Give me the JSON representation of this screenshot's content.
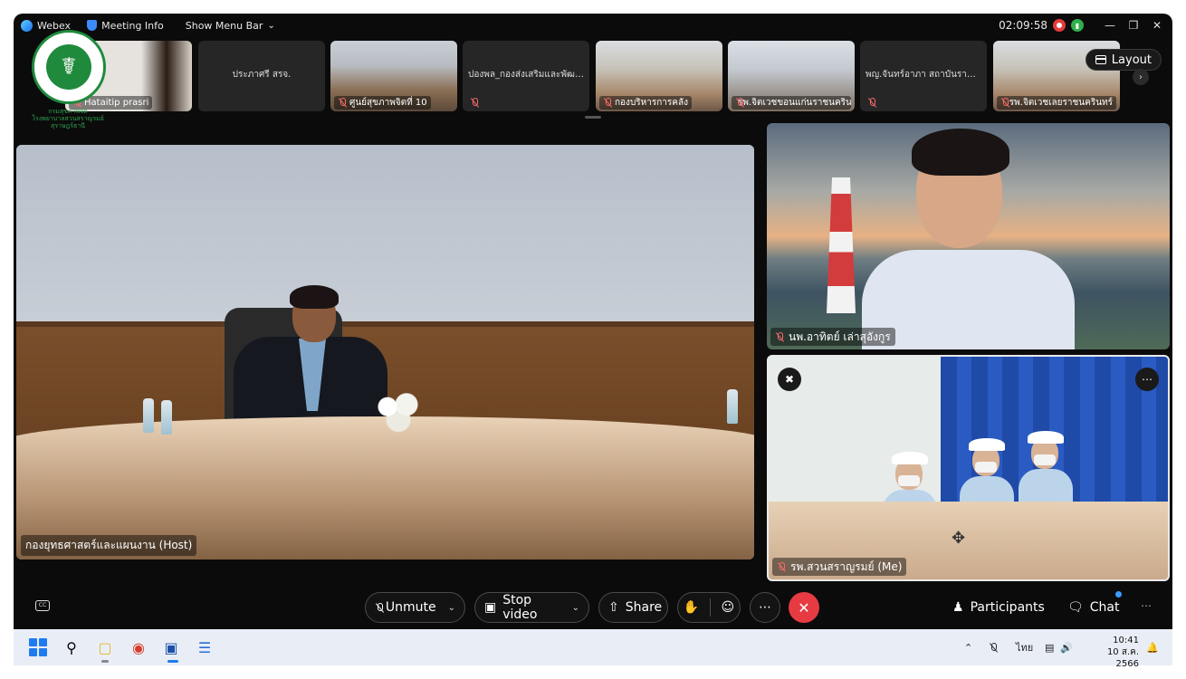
{
  "app": {
    "name": "Webex",
    "meeting_info": "Meeting Info",
    "show_menu_bar": "Show Menu Bar",
    "timer": "02:09:58"
  },
  "logo": {
    "text_line1": "กรมสุขภาพจิต",
    "text_line2": "โรงพยาบาลสวนสราญรมย์",
    "text_line3": "สุราษฎร์ธานี"
  },
  "thumbnails": [
    {
      "name": "Hataitip prasri",
      "muted": true
    },
    {
      "name": "ประภาศรี สรจ.",
      "muted": false
    },
    {
      "name": "ศูนย์สุขภาพจิตที่ 10",
      "muted": true
    },
    {
      "name": "ปองพล_กองส่งเสริมและพัฒน...",
      "muted": true
    },
    {
      "name": "กองบริหารการคลัง",
      "muted": true
    },
    {
      "name": "รพ.จิตเวชขอนแก่นราชนครินทร์",
      "muted": true
    },
    {
      "name": "พญ.จันทร์อาภา สถาบันราชา...",
      "muted": true
    },
    {
      "name": "รพ.จิตเวชเลยราชนครินทร์",
      "muted": true
    }
  ],
  "layout_label": "Layout",
  "main_video": {
    "label": "กองยุทธศาสตร์และแผนงาน (Host)"
  },
  "right_videos": [
    {
      "label": "นพ.อาทิตย์ เล่าสุอังกูร"
    },
    {
      "label": "รพ.สวนสราญรมย์ (Me)"
    }
  ],
  "controls": {
    "unmute": "Unmute",
    "stop_video": "Stop video",
    "share": "Share",
    "participants": "Participants",
    "chat": "Chat"
  },
  "taskbar": {
    "language": "ไทย",
    "time": "10:41",
    "date": "10 ส.ค. 2566"
  },
  "colors": {
    "end_call": "#e63b43",
    "accent": "#3b9cff",
    "muted_mic": "#ff6b6b"
  }
}
